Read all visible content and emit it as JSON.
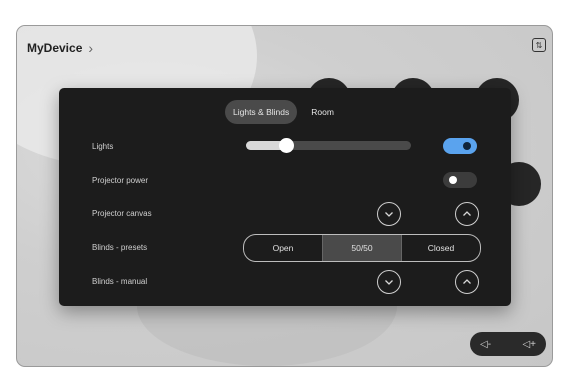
{
  "header": {
    "device_name": "MyDevice",
    "chevron": "›",
    "top_icon": "sort-icon"
  },
  "panel": {
    "tabs": [
      {
        "label": "Lights & Blinds",
        "active": true
      },
      {
        "label": "Room",
        "active": false
      }
    ],
    "rows": {
      "lights": {
        "label": "Lights",
        "level": 0.24,
        "toggle_on": true
      },
      "projector_power": {
        "label": "Projector power",
        "toggle_on": false
      },
      "projector_canvas": {
        "label": "Projector canvas",
        "down_icon": "chevron-down-icon",
        "up_icon": "chevron-up-icon"
      },
      "blinds_presets": {
        "label": "Blinds - presets",
        "options": [
          "Open",
          "50/50",
          "Closed"
        ],
        "selected": "50/50"
      },
      "blinds_manual": {
        "label": "Blinds - manual",
        "down_icon": "chevron-down-icon",
        "up_icon": "chevron-up-icon"
      }
    }
  },
  "volume": {
    "down_icon": "volume-down-icon",
    "up_icon": "volume-up-icon",
    "down_glyph": "◁-",
    "up_glyph": "◁+"
  },
  "colors": {
    "toggle_on": "#5aa3ee",
    "panel_bg": "#1c1c1c"
  }
}
